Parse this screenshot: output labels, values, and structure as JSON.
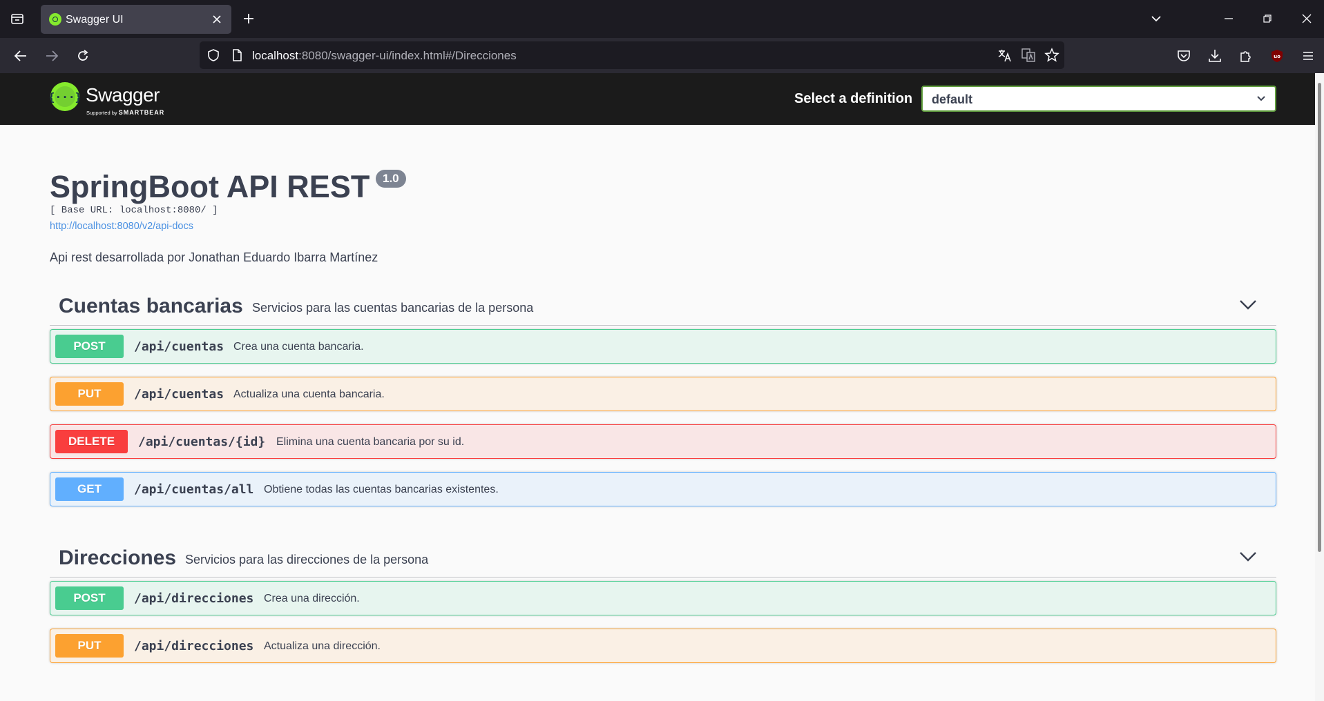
{
  "browser": {
    "tab_title": "Swagger UI",
    "url_host": "localhost",
    "url_rest": ":8080/swagger-ui/index.html#/Direcciones"
  },
  "topbar": {
    "logo_word": "Swagger",
    "logo_sub_prefix": "Supported by ",
    "logo_sub_brand": "SMARTBEAR",
    "definition_label": "Select a definition",
    "definition_value": "default",
    "accent_color": "#85ea2d"
  },
  "info": {
    "title": "SpringBoot API REST",
    "version": "1.0",
    "base_url": "[ Base URL: localhost:8080/ ]",
    "docs_link": "http://localhost:8080/v2/api-docs",
    "description": "Api rest desarrollada por Jonathan Eduardo Ibarra Martínez"
  },
  "tags": [
    {
      "name": "Cuentas bancarias",
      "description": "Servicios para las cuentas bancarias de la persona",
      "operations": [
        {
          "method": "POST",
          "path": "/api/cuentas",
          "summary": "Crea una cuenta bancaria."
        },
        {
          "method": "PUT",
          "path": "/api/cuentas",
          "summary": "Actualiza una cuenta bancaria."
        },
        {
          "method": "DELETE",
          "path": "/api/cuentas/{id}",
          "summary": "Elimina una cuenta bancaria por su id."
        },
        {
          "method": "GET",
          "path": "/api/cuentas/all",
          "summary": "Obtiene todas las cuentas bancarias existentes."
        }
      ]
    },
    {
      "name": "Direcciones",
      "description": "Servicios para las direcciones de la persona",
      "operations": [
        {
          "method": "POST",
          "path": "/api/direcciones",
          "summary": "Crea una dirección."
        },
        {
          "method": "PUT",
          "path": "/api/direcciones",
          "summary": "Actualiza una dirección."
        }
      ]
    }
  ],
  "method_colors": {
    "POST": "#49cc90",
    "PUT": "#fca130",
    "DELETE": "#f93e3e",
    "GET": "#61affe"
  }
}
